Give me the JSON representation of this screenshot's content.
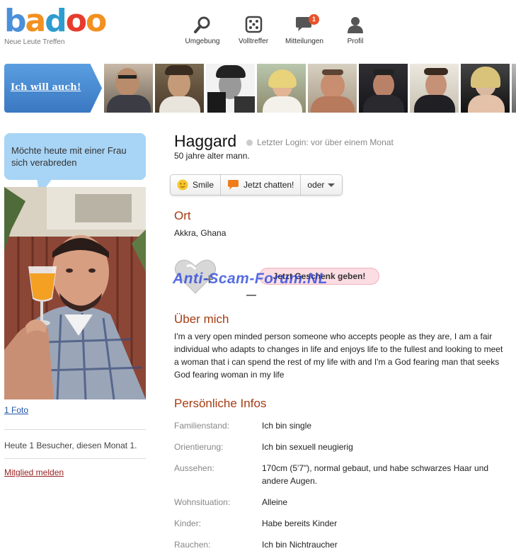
{
  "brand": {
    "tagline": "Neue Leute Treffen"
  },
  "nav": [
    {
      "label": "Umgebung",
      "icon": "search-icon"
    },
    {
      "label": "Volltreffer",
      "icon": "dice-icon"
    },
    {
      "label": "Mitteilungen",
      "icon": "chat-bubble-icon",
      "badge": "1"
    },
    {
      "label": "Profil",
      "icon": "person-icon"
    }
  ],
  "strip": {
    "cta": "Ich will auch!"
  },
  "left": {
    "bubble": "Möchte heute mit einer Frau sich verabreden",
    "photo_link": "1 Foto",
    "visitors": "Heute 1 Besucher, diesen Monat 1.",
    "report": "Mitglied melden"
  },
  "profile": {
    "name": "Haggard",
    "last_login": "Letzter Login: vor über einem Monat",
    "age_line": "50 jahre alter mann."
  },
  "actions": {
    "smile": "Smile",
    "chat": "Jetzt chatten!",
    "more": "oder"
  },
  "ort": {
    "title": "Ort",
    "value": "Akkra, Ghana"
  },
  "gift": {
    "button": "Jetzt Geschenk geben!",
    "watermark": "Anti-Scam-Forum.NL"
  },
  "about": {
    "title": "Über mich",
    "text": "I'm a very open minded person someone who accepts people as they are, I am a fair individual who adapts to changes in life and enjoys life to the fullest and looking to meet a woman that i can spend the rest of my life with and I'm a God fearing man that seeks God fearing woman in my life"
  },
  "infos": {
    "title": "Persönliche Infos",
    "rows": [
      {
        "label": "Familienstand:",
        "value": "Ich bin single"
      },
      {
        "label": "Orientierung:",
        "value": "Ich bin sexuell neugierig"
      },
      {
        "label": "Aussehen:",
        "value": "170cm (5'7\"), normal gebaut, und habe schwarzes Haar und andere Augen."
      },
      {
        "label": "Wohnsituation:",
        "value": "Alleine"
      },
      {
        "label": "Kinder:",
        "value": "Habe bereits Kinder"
      },
      {
        "label": "Rauchen:",
        "value": "Ich bin Nichtraucher"
      }
    ]
  },
  "colors": {
    "section_title": "#a63b12",
    "bubble": "#a8d4f5",
    "cta": "#3a78c2"
  }
}
